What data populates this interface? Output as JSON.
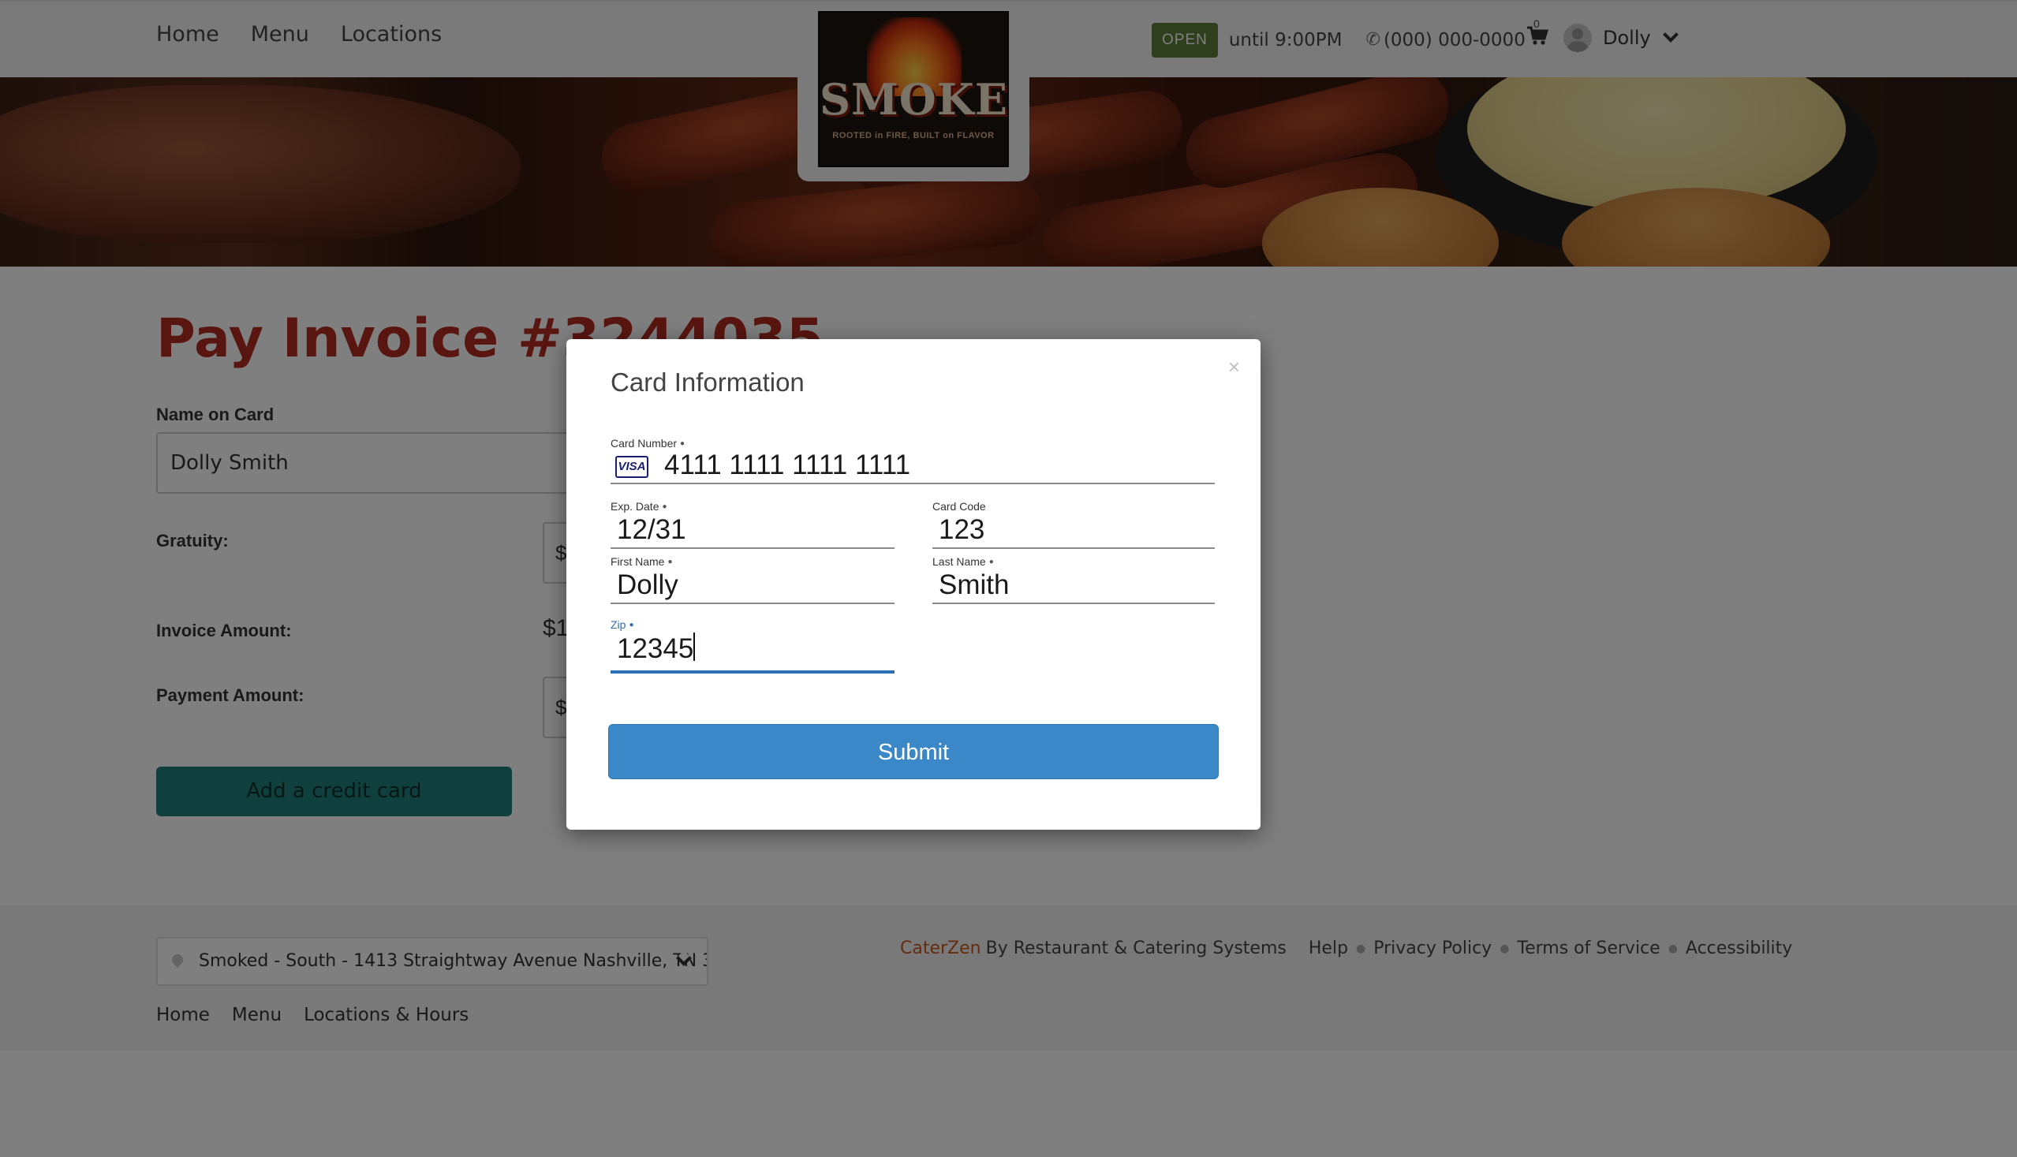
{
  "header": {
    "nav": [
      "Home",
      "Menu",
      "Locations"
    ],
    "logo": {
      "title": "SMOKED",
      "tagline": "ROOTED in FIRE, BUILT on FLAVOR"
    },
    "status_badge": "OPEN",
    "hours_text": "until 9:00PM",
    "phone": "(000) 000-0000",
    "cart_count": "0",
    "user_name": "Dolly"
  },
  "page": {
    "title": "Pay Invoice #3244035",
    "name_on_card_label": "Name on Card",
    "name_on_card_value": "Dolly Smith",
    "gratuity_label": "Gratuity:",
    "gratuity_prefix": "$",
    "invoice_amount_label": "Invoice Amount:",
    "invoice_amount_value": "$1",
    "payment_amount_label": "Payment Amount:",
    "payment_prefix": "$",
    "add_card_button": "Add a credit card"
  },
  "modal": {
    "title": "Card Information",
    "close": "×",
    "card_number_label": "Card Number",
    "card_brand": "VISA",
    "card_number": "4111 1111 1111 1111",
    "exp_label": "Exp. Date",
    "exp_value": "12/31",
    "code_label": "Card Code",
    "code_value": "123",
    "first_name_label": "First Name",
    "first_name_value": "Dolly",
    "last_name_label": "Last Name",
    "last_name_value": "Smith",
    "zip_label": "Zip",
    "zip_value": "12345",
    "required_marker": "●",
    "submit": "Submit"
  },
  "footer": {
    "location_select": "Smoked - South - 1413 Straightway Avenue Nashville, TN 3",
    "nav": [
      "Home",
      "Menu",
      "Locations & Hours"
    ],
    "brand": "CaterZen",
    "brand_suffix": "By Restaurant & Catering Systems",
    "links": [
      "Help",
      "Privacy Policy",
      "Terms of Service",
      "Accessibility"
    ],
    "separator": "●"
  },
  "colors": {
    "title_red": "#b32d20",
    "open_green": "#5f7d3a",
    "teal_button": "#20807a",
    "submit_blue": "#3a88c8",
    "brand_orange": "#c8571a"
  }
}
